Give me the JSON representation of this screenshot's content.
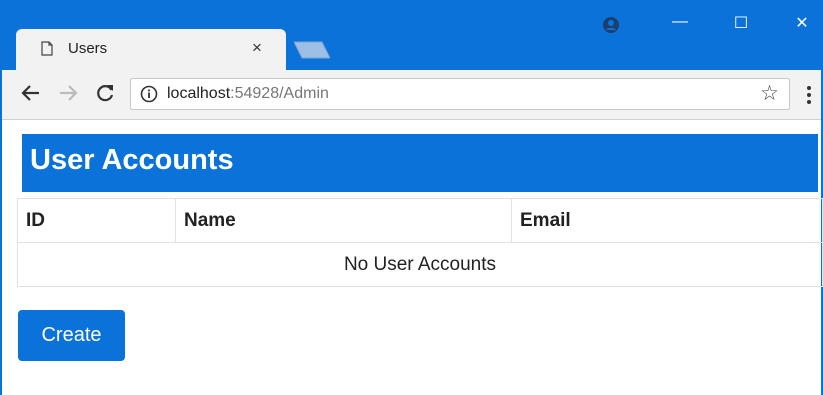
{
  "browser": {
    "tab_title": "Users",
    "tab_close": "×",
    "url_host": "localhost",
    "url_path": ":54928/Admin"
  },
  "icons": {
    "back": "arrow-left",
    "forward": "arrow-right",
    "reload": "reload",
    "info": "info-circle",
    "bookmark": "star",
    "menu": "vertical-dots",
    "profile": "account-circle"
  },
  "window_controls": {
    "minimize": "—",
    "maximize": "☐",
    "close": "✕"
  },
  "page": {
    "heading": "User Accounts",
    "table": {
      "columns": [
        "ID",
        "Name",
        "Email"
      ],
      "empty_message": "No User Accounts"
    },
    "create_label": "Create"
  },
  "colors": {
    "accent": "#0a72d8",
    "chrome_bg": "#f2f2f2"
  }
}
